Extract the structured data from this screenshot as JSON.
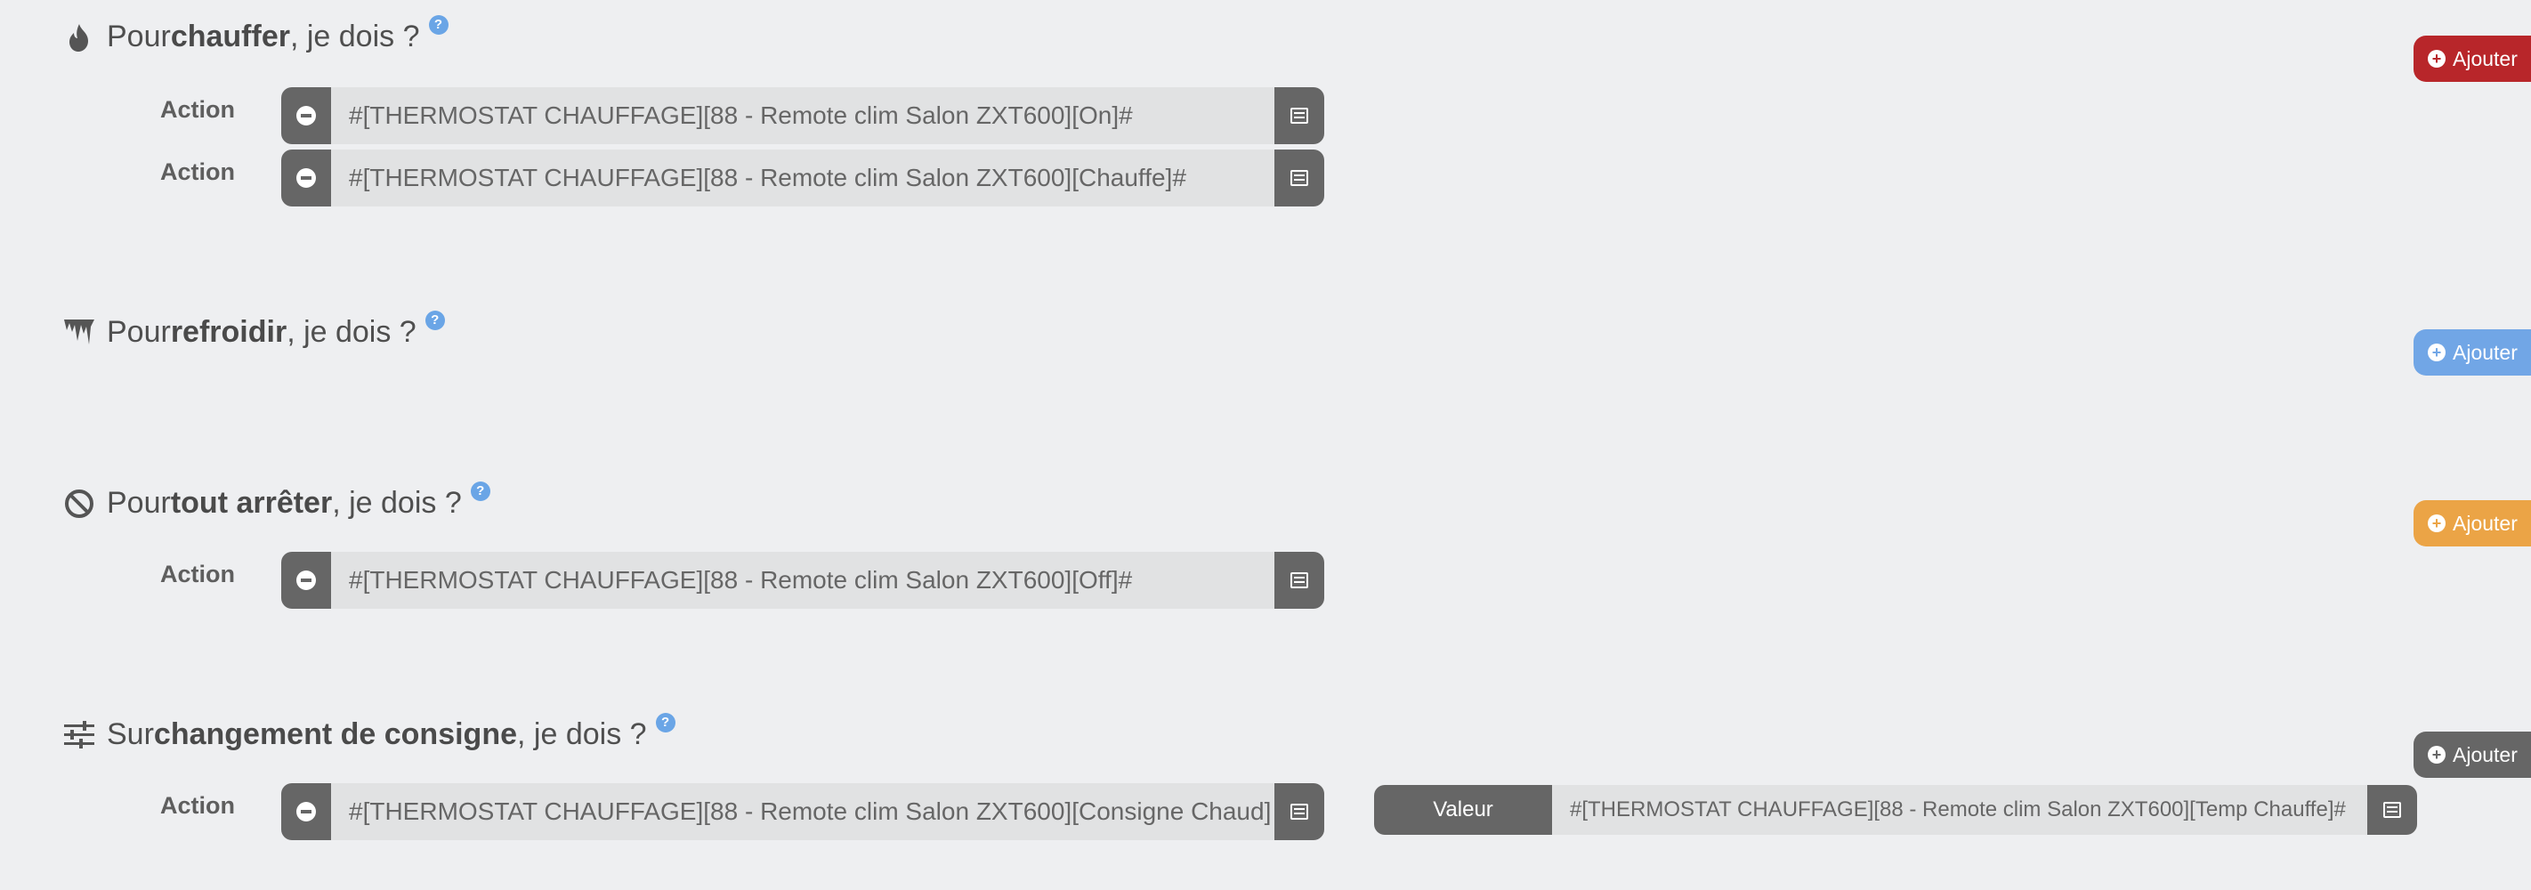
{
  "sections": {
    "heat": {
      "prefix": "Pour ",
      "bold": "chauffer",
      "suffix": ", je dois ?",
      "help": "?",
      "add_label": "Ajouter",
      "add_color": "#b8262a",
      "actions": [
        {
          "label": "Action",
          "value": "#[THERMOSTAT CHAUFFAGE][88 - Remote clim Salon ZXT600][On]#"
        },
        {
          "label": "Action",
          "value": "#[THERMOSTAT CHAUFFAGE][88 - Remote clim Salon ZXT600][Chauffe]#"
        }
      ]
    },
    "cool": {
      "prefix": "Pour ",
      "bold": "refroidir",
      "suffix": ", je dois ?",
      "help": "?",
      "add_label": "Ajouter",
      "add_color": "#71a6e6"
    },
    "stop": {
      "prefix": "Pour ",
      "bold": "tout arrêter",
      "suffix": ", je dois ?",
      "help": "?",
      "add_label": "Ajouter",
      "add_color": "#eba446",
      "actions": [
        {
          "label": "Action",
          "value": "#[THERMOSTAT CHAUFFAGE][88 - Remote clim Salon ZXT600][Off]#"
        }
      ]
    },
    "setpoint": {
      "prefix": "Sur ",
      "bold": "changement de consigne",
      "suffix": ", je dois ?",
      "help": "?",
      "add_label": "Ajouter",
      "add_color": "#666666",
      "actions": [
        {
          "label": "Action",
          "value": "#[THERMOSTAT CHAUFFAGE][88 - Remote clim Salon ZXT600][Consigne Chaud]",
          "value_label": "Valeur",
          "value_input": "#[THERMOSTAT CHAUFFAGE][88 - Remote clim Salon ZXT600][Temp Chauffe]#"
        }
      ]
    }
  },
  "icons": {
    "heat": "fire-icon",
    "cool": "icicles-icon",
    "stop": "ban-icon",
    "setpoint": "sliders-icon",
    "remove": "minus-circle-icon",
    "list": "list-alt-icon",
    "add": "plus-circle-icon"
  }
}
